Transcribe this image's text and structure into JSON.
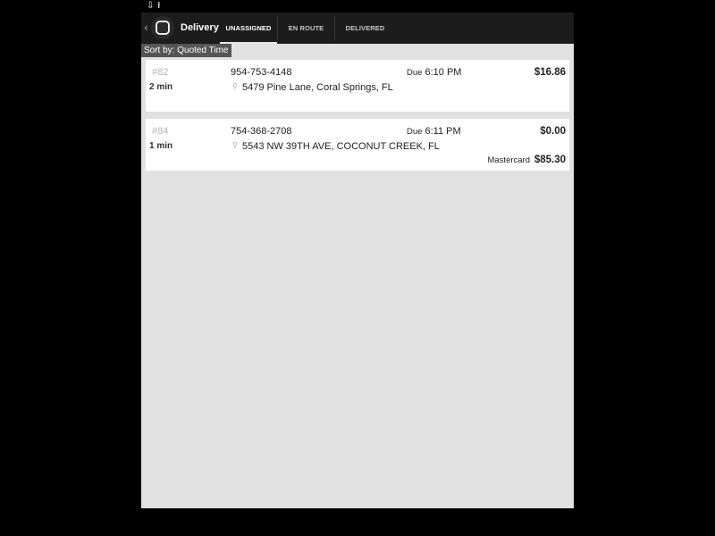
{
  "app": {
    "title": "Delivery",
    "tabs": [
      {
        "label": "UNASSIGNED",
        "active": true
      },
      {
        "label": "EN ROUTE",
        "active": false
      },
      {
        "label": "DELIVERED",
        "active": false
      }
    ],
    "sort_label": "Sort by: Quoted Time"
  },
  "orders": [
    {
      "number": "#82",
      "elapsed": "2 min",
      "phone": "954-753-4148",
      "address": "5479 Pine Lane, Coral Springs, FL",
      "due_word": "Due",
      "due_time": "6:10 PM",
      "amount": "$16.86"
    },
    {
      "number": "#84",
      "elapsed": "1 min",
      "phone": "754-368-2708",
      "address": "5543 NW 39TH AVE, COCONUT CREEK, FL",
      "due_word": "Due",
      "due_time": "6:11 PM",
      "amount": "$0.00",
      "payment_method": "Mastercard",
      "payment_amount": "$85.30"
    }
  ],
  "icons": {
    "status_left": "download-notification-icon",
    "status_right": "upload-icon",
    "back": "chevron-left-icon",
    "logo": "app-logo-icon",
    "address": "map-pin-icon"
  },
  "colors": {
    "topbar": "#1c1c1c",
    "screen_background": "#e1e1e1",
    "card_background": "#ffffff",
    "sort_badge": "#555555"
  }
}
